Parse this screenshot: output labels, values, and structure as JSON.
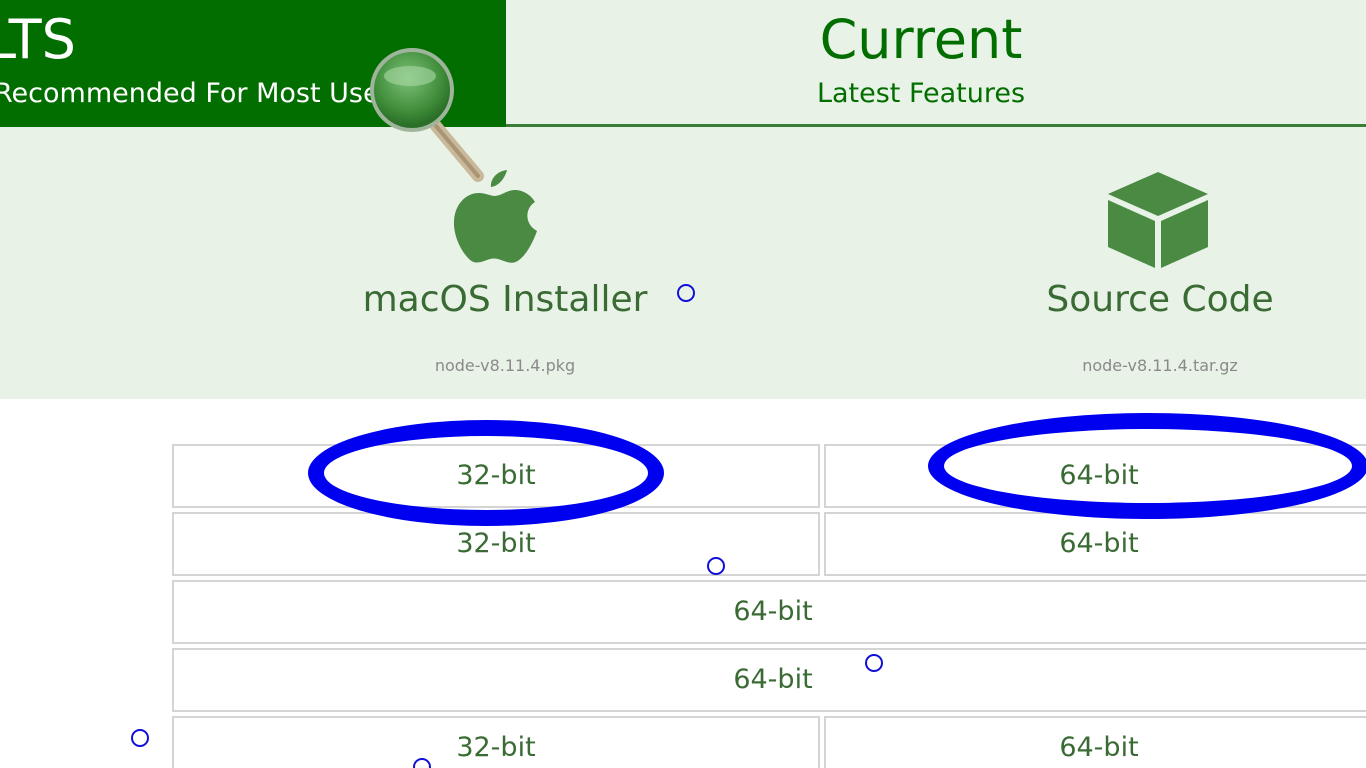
{
  "tabs": {
    "lts": {
      "title": "LTS",
      "subtitle": "Recommended For Most Users"
    },
    "current": {
      "title": "Current",
      "subtitle": "Latest Features"
    }
  },
  "downloads": {
    "mac": {
      "label": "macOS Installer",
      "file": "node-v8.11.4.pkg",
      "icon": "apple-icon"
    },
    "source": {
      "label": "Source Code",
      "file": "node-v8.11.4.tar.gz",
      "icon": "cube-icon"
    }
  },
  "arch_rows": [
    [
      "32-bit",
      "64-bit"
    ],
    [
      "32-bit",
      "64-bit"
    ],
    [
      "64-bit"
    ],
    [
      "64-bit"
    ],
    [
      "32-bit",
      "64-bit"
    ]
  ],
  "colors": {
    "brand_green": "#026e00",
    "panel_bg": "#e8f2e6",
    "text_green": "#3a6b34",
    "annotation_blue": "#0000f0"
  }
}
